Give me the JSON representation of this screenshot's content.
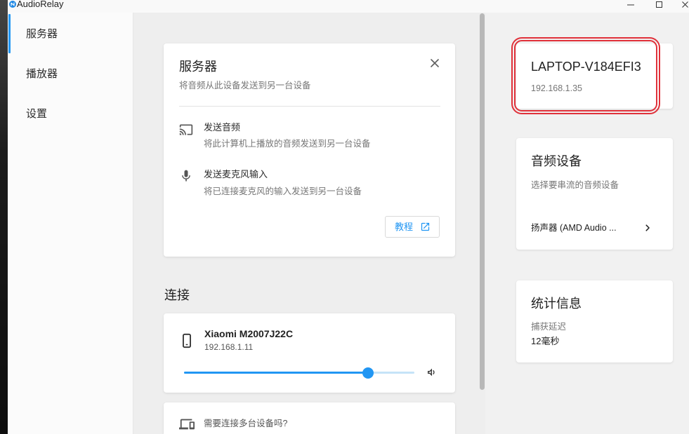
{
  "window": {
    "title": "AudioRelay",
    "app_icon": "audiorelay-logo-icon",
    "controls": [
      "minimize-icon",
      "maximize-icon",
      "close-icon"
    ]
  },
  "theme": {
    "accent": "#2196f3",
    "annotation": "#e0313a"
  },
  "sidebar": {
    "items": [
      {
        "label": "服务器",
        "selected": true
      },
      {
        "label": "播放器",
        "selected": false
      },
      {
        "label": "设置",
        "selected": false
      }
    ]
  },
  "server_card": {
    "title": "服务器",
    "subtitle": "将音频从此设备发送到另一台设备",
    "close_icon": "close-icon",
    "options": [
      {
        "icon": "cast-icon",
        "title": "发送音频",
        "description": "将此计算机上播放的音频发送到另一台设备"
      },
      {
        "icon": "microphone-icon",
        "title": "发送麦克风输入",
        "description": "将已连接麦克风的输入发送到另一台设备"
      }
    ],
    "tutorial_button": {
      "label": "教程",
      "icon": "external-link-icon"
    }
  },
  "connections": {
    "heading": "连接",
    "devices": [
      {
        "icon": "smartphone-icon",
        "name": "Xiaomi M2007J22C",
        "ip": "192.168.1.11",
        "volume": 0.8
      }
    ],
    "multi_device": {
      "icon": "devices-icon",
      "text": "需要连接多台设备吗?"
    }
  },
  "host": {
    "name": "LAPTOP-V184EFI3",
    "ip": "192.168.1.35",
    "highlighted": true
  },
  "audio_device": {
    "title": "音频设备",
    "subtitle": "选择要串流的音频设备",
    "selected": "扬声器 (AMD Audio ...",
    "icon": "chevron-right-icon"
  },
  "statistics": {
    "title": "统计信息",
    "latency_label": "捕获延迟",
    "latency_value": "12毫秒"
  }
}
